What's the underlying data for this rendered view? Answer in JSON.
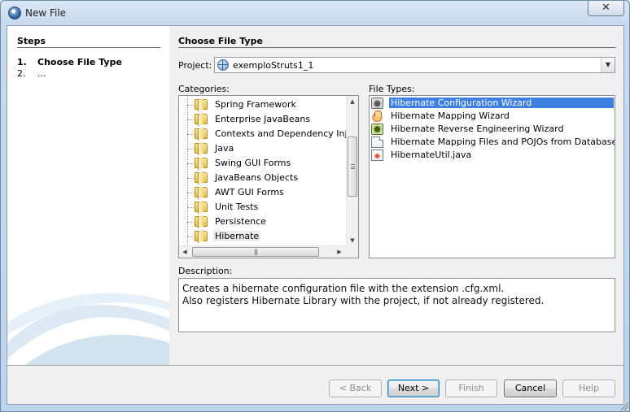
{
  "window": {
    "title": "New File",
    "close_label": "✕"
  },
  "steps": {
    "title": "Steps",
    "items": [
      {
        "num": "1.",
        "label": "Choose File Type"
      },
      {
        "num": "2.",
        "label": "..."
      }
    ]
  },
  "content": {
    "title": "Choose File Type",
    "project_label": "Project:",
    "project_value": "exemploStruts1_1",
    "categories_label": "Categories:",
    "file_types_label": "File Types:",
    "description_label": "Description:",
    "description_lines": [
      "Creates a hibernate configuration file with the extension .cfg.xml.",
      "Also registers Hibernate Library with the project, if not already registered."
    ]
  },
  "categories": [
    {
      "label": "Spring Framework",
      "selected": false
    },
    {
      "label": "Enterprise JavaBeans",
      "selected": false
    },
    {
      "label": "Contexts and Dependency Inject",
      "selected": false
    },
    {
      "label": "Java",
      "selected": false
    },
    {
      "label": "Swing GUI Forms",
      "selected": false
    },
    {
      "label": "JavaBeans Objects",
      "selected": false
    },
    {
      "label": "AWT GUI Forms",
      "selected": false
    },
    {
      "label": "Unit Tests",
      "selected": false
    },
    {
      "label": "Persistence",
      "selected": false
    },
    {
      "label": "Hibernate",
      "selected": true
    }
  ],
  "file_types": [
    {
      "label": "Hibernate Configuration Wizard",
      "icon": "wizard-icon",
      "selected": true
    },
    {
      "label": "Hibernate Mapping Wizard",
      "icon": "hand-icon",
      "selected": false
    },
    {
      "label": "Hibernate Reverse Engineering Wizard",
      "icon": "reverse-wizard-icon",
      "selected": false
    },
    {
      "label": "Hibernate Mapping Files and POJOs from Database",
      "icon": "document-icon",
      "selected": false
    },
    {
      "label": "HibernateUtil.java",
      "icon": "java-file-icon",
      "selected": false
    }
  ],
  "buttons": {
    "back": "< Back",
    "next": "Next >",
    "finish": "Finish",
    "cancel": "Cancel",
    "help": "Help"
  },
  "colors": {
    "selection": "#3d80df",
    "title_bar": "#c7daee"
  }
}
